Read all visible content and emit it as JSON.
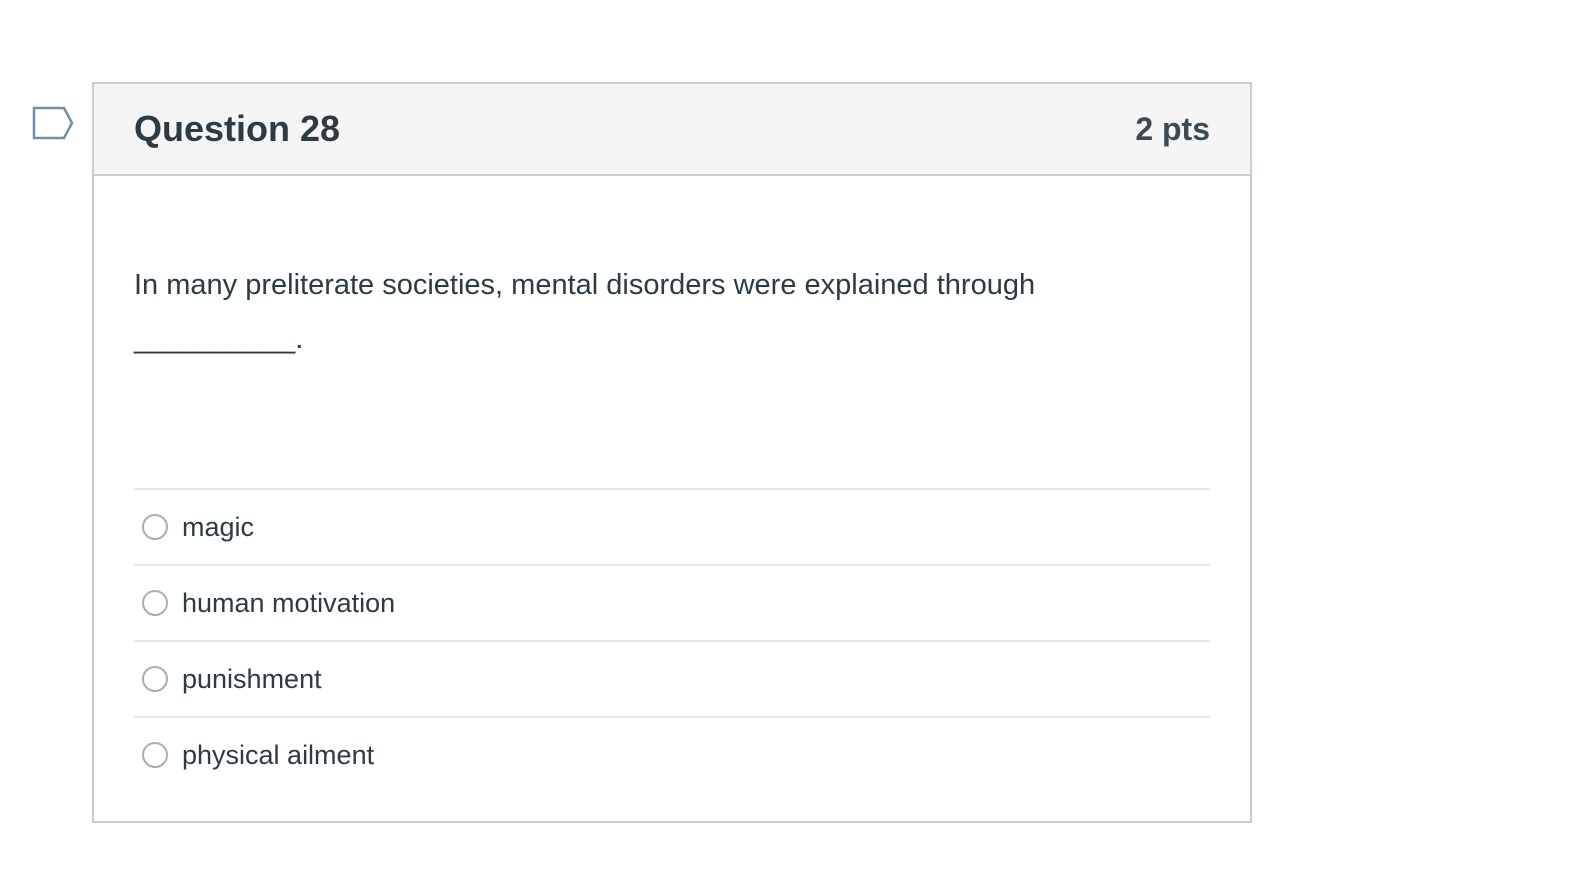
{
  "question": {
    "title": "Question 28",
    "points": "2 pts",
    "text": "In many preliterate societies, mental disorders were explained through __________.",
    "answers": [
      {
        "label": "magic",
        "selected": false
      },
      {
        "label": "human motivation",
        "selected": false
      },
      {
        "label": "punishment",
        "selected": false
      },
      {
        "label": "physical ailment",
        "selected": false
      }
    ]
  },
  "icons": {
    "flag": "flag-question-icon"
  },
  "colors": {
    "flag_stroke": "#6b8fae",
    "header_bg": "#f5f5f5",
    "border": "#c7cdd1",
    "text": "#2d3b45"
  }
}
